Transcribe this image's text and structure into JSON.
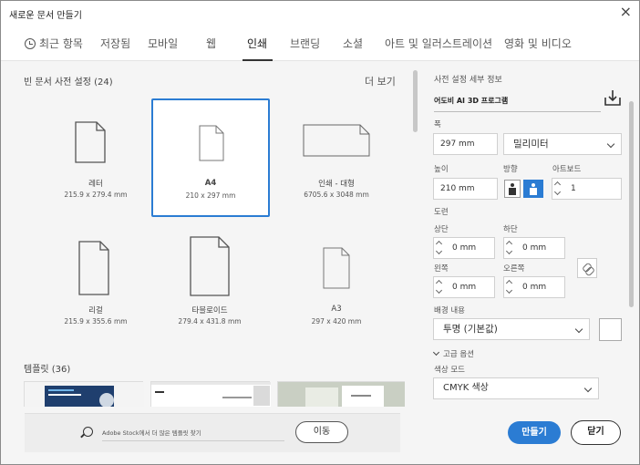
{
  "window": {
    "title": "새로운 문서 만들기",
    "close_glyph": "×"
  },
  "tabs": [
    {
      "label": "최근 항목"
    },
    {
      "label": "저장됨"
    },
    {
      "label": "모바일"
    },
    {
      "label": "웹"
    },
    {
      "label": "인쇄"
    },
    {
      "label": "브랜딩"
    },
    {
      "label": "소셜"
    },
    {
      "label": "아트 및 일러스트레이션"
    },
    {
      "label": "영화 및 비디오"
    }
  ],
  "presets_section": {
    "title": "빈 문서 사전 설정 (24)",
    "more_label": "더 보기",
    "items": [
      {
        "name": "레터",
        "size": "215.9 x 279.4 mm"
      },
      {
        "name": "A4",
        "size": "210 x 297 mm"
      },
      {
        "name": "인쇄 - 대형",
        "size": "6705.6 x 3048 mm"
      },
      {
        "name": "리걸",
        "size": "215.9 x 355.6 mm"
      },
      {
        "name": "타블로이드",
        "size": "279.4 x 431.8 mm"
      },
      {
        "name": "A3",
        "size": "297 x 420 mm"
      }
    ]
  },
  "templates_section": {
    "title": "템플릿 (36)"
  },
  "search": {
    "placeholder": "Adobe Stock에서 더 많은 템플릿 찾기",
    "go_label": "이동"
  },
  "details": {
    "header": "사전 설정 세부 정보",
    "preset_name": "어도비 AI 3D 프로그램",
    "width_label": "폭",
    "width_value": "297 mm",
    "unit_value": "밀리미터",
    "height_label": "높이",
    "height_value": "210 mm",
    "orientation_label": "방향",
    "artboards_label": "아트보드",
    "artboards_value": "1",
    "bleed_label": "도련",
    "top_label": "상단",
    "top_value": "0 mm",
    "bottom_label": "하단",
    "bottom_value": "0 mm",
    "left_label": "왼쪽",
    "left_value": "0 mm",
    "right_label": "오른쪽",
    "right_value": "0 mm",
    "background_label": "배경 내용",
    "background_value": "투명 (기본값)",
    "advanced_label": "고급 옵션",
    "color_mode_label": "색상 모드",
    "color_mode_value": "CMYK 색상"
  },
  "footer": {
    "create_label": "만들기",
    "close_label": "닫기"
  },
  "colors": {
    "accent": "#2b7cd3"
  }
}
